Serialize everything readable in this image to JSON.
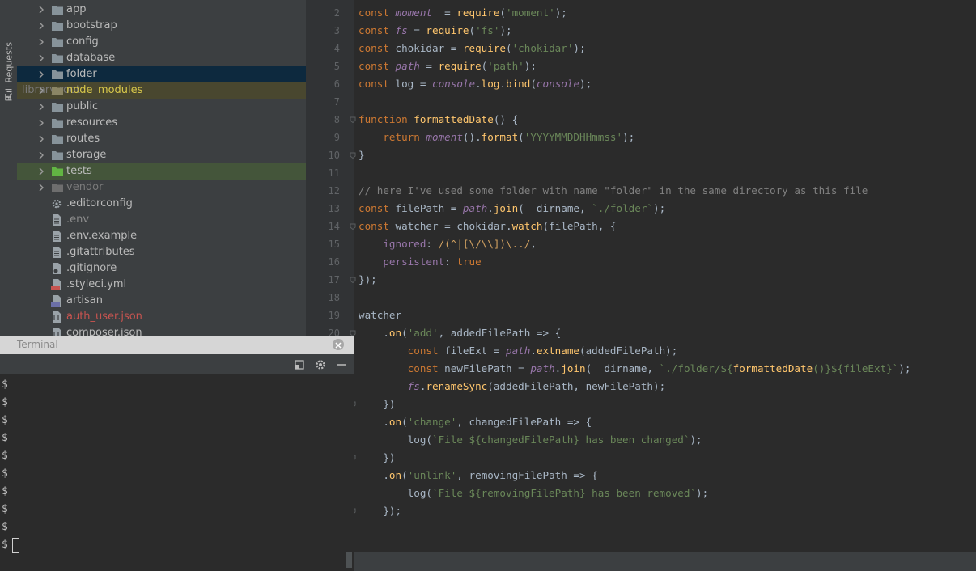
{
  "toolstrip": {
    "pull_requests_label": "Pull Requests"
  },
  "tree": {
    "folders": [
      {
        "label": "app",
        "state": "normal"
      },
      {
        "label": "bootstrap",
        "state": "normal"
      },
      {
        "label": "config",
        "state": "normal"
      },
      {
        "label": "database",
        "state": "normal"
      },
      {
        "label": "folder",
        "state": "selected"
      },
      {
        "label": "node_modules",
        "state": "library",
        "suffix": "library root"
      },
      {
        "label": "public",
        "state": "normal"
      },
      {
        "label": "resources",
        "state": "normal"
      },
      {
        "label": "routes",
        "state": "normal"
      },
      {
        "label": "storage",
        "state": "normal"
      },
      {
        "label": "tests",
        "state": "tests"
      },
      {
        "label": "vendor",
        "state": "excluded"
      }
    ],
    "files": [
      {
        "label": ".editorconfig",
        "icon": "gear-icon",
        "color": "#bbbbbb"
      },
      {
        "label": ".env",
        "icon": "text-file-icon",
        "color": "#8c8c8c"
      },
      {
        "label": ".env.example",
        "icon": "text-file-icon",
        "color": "#bbbbbb"
      },
      {
        "label": ".gitattributes",
        "icon": "text-file-icon",
        "color": "#bbbbbb"
      },
      {
        "label": ".gitignore",
        "icon": "gitignore-file-icon",
        "color": "#bbbbbb"
      },
      {
        "label": ".styleci.yml",
        "icon": "yaml-file-icon",
        "color": "#bbbbbb"
      },
      {
        "label": "artisan",
        "icon": "php-file-icon",
        "color": "#bbbbbb"
      },
      {
        "label": "auth_user.json",
        "icon": "json-file-icon",
        "color": "#c75450"
      },
      {
        "label": "composer.json",
        "icon": "json-file-icon",
        "color": "#bbbbbb"
      }
    ]
  },
  "editor": {
    "line_numbers": [
      "2",
      "3",
      "4",
      "5",
      "6",
      "7",
      "8",
      "9",
      "10",
      "11",
      "12",
      "13",
      "14",
      "15",
      "16",
      "17",
      "18",
      "19",
      "20"
    ],
    "lines": [
      [
        [
          "kw",
          "const "
        ],
        [
          "pv",
          "moment"
        ],
        [
          "",
          "  = "
        ],
        [
          "fn",
          "require"
        ],
        [
          "",
          "("
        ],
        [
          "str",
          "'moment'"
        ],
        [
          "",
          ");"
        ]
      ],
      [
        [
          "kw",
          "const "
        ],
        [
          "pv",
          "fs"
        ],
        [
          "",
          " = "
        ],
        [
          "fn",
          "require"
        ],
        [
          "",
          "("
        ],
        [
          "str",
          "'fs'"
        ],
        [
          "",
          ");"
        ]
      ],
      [
        [
          "kw",
          "const "
        ],
        [
          "",
          "chokidar = "
        ],
        [
          "fn",
          "require"
        ],
        [
          "",
          "("
        ],
        [
          "str",
          "'chokidar'"
        ],
        [
          "",
          ");"
        ]
      ],
      [
        [
          "kw",
          "const "
        ],
        [
          "pv",
          "path"
        ],
        [
          "",
          " = "
        ],
        [
          "fn",
          "require"
        ],
        [
          "",
          "("
        ],
        [
          "str",
          "'path'"
        ],
        [
          "",
          ");"
        ]
      ],
      [
        [
          "kw",
          "const "
        ],
        [
          "",
          "log = "
        ],
        [
          "pv",
          "console"
        ],
        [
          "",
          "."
        ],
        [
          "fn",
          "log"
        ],
        [
          "",
          "."
        ],
        [
          "fn",
          "bind"
        ],
        [
          "",
          "("
        ],
        [
          "pv",
          "console"
        ],
        [
          "",
          ");"
        ]
      ],
      [],
      [
        [
          "kw",
          "function "
        ],
        [
          "fn",
          "formattedDate"
        ],
        [
          "",
          "() {"
        ]
      ],
      [
        [
          "",
          "    "
        ],
        [
          "kw",
          "return "
        ],
        [
          "pv",
          "moment"
        ],
        [
          "",
          "()."
        ],
        [
          "fn",
          "format"
        ],
        [
          "",
          "("
        ],
        [
          "str",
          "'YYYYMMDDHHmmss'"
        ],
        [
          "",
          ");"
        ]
      ],
      [
        [
          "",
          "}"
        ]
      ],
      [],
      [
        [
          "cm",
          "// here I've used some folder with name \"folder\" in the same directory as this file"
        ]
      ],
      [
        [
          "kw",
          "const "
        ],
        [
          "",
          "filePath = "
        ],
        [
          "pv",
          "path"
        ],
        [
          "",
          "."
        ],
        [
          "fn",
          "join"
        ],
        [
          "",
          "(__dirname, "
        ],
        [
          "str",
          "`./folder`"
        ],
        [
          "",
          ");"
        ]
      ],
      [
        [
          "kw",
          "const "
        ],
        [
          "",
          "watcher = chokidar."
        ],
        [
          "fn",
          "watch"
        ],
        [
          "",
          "(filePath, {"
        ]
      ],
      [
        [
          "",
          "    "
        ],
        [
          "prop",
          "ignored"
        ],
        [
          "",
          ": "
        ],
        [
          "rx",
          "/(^|[\\/\\\\])\\../"
        ],
        [
          "",
          ","
        ]
      ],
      [
        [
          "",
          "    "
        ],
        [
          "prop",
          "persistent"
        ],
        [
          "",
          ": "
        ],
        [
          "kw",
          "true"
        ]
      ],
      [
        [
          "",
          "});"
        ]
      ],
      [],
      [
        [
          "",
          "watcher"
        ]
      ],
      [
        [
          "",
          "    ."
        ],
        [
          "fn",
          "on"
        ],
        [
          "",
          "("
        ],
        [
          "str",
          "'add'"
        ],
        [
          "",
          ", addedFilePath => {"
        ]
      ],
      [
        [
          "",
          "        "
        ],
        [
          "kw",
          "const "
        ],
        [
          "",
          "fileExt = "
        ],
        [
          "pv",
          "path"
        ],
        [
          "",
          "."
        ],
        [
          "fn",
          "extname"
        ],
        [
          "",
          "(addedFilePath);"
        ]
      ],
      [
        [
          "",
          "        "
        ],
        [
          "kw",
          "const "
        ],
        [
          "",
          "newFilePath = "
        ],
        [
          "pv",
          "path"
        ],
        [
          "",
          "."
        ],
        [
          "fn",
          "join"
        ],
        [
          "",
          "(__dirname, "
        ],
        [
          "str",
          "`./folder/${"
        ],
        [
          "fn",
          "formattedDate"
        ],
        [
          "str",
          "()}${fileExt}`"
        ],
        [
          "",
          ");"
        ]
      ],
      [
        [
          "",
          "        "
        ],
        [
          "pv",
          "fs"
        ],
        [
          "",
          "."
        ],
        [
          "fn",
          "renameSync"
        ],
        [
          "",
          "(addedFilePath, newFilePath);"
        ]
      ],
      [
        [
          "",
          "    })"
        ]
      ],
      [
        [
          "",
          "    ."
        ],
        [
          "fn",
          "on"
        ],
        [
          "",
          "("
        ],
        [
          "str",
          "'change'"
        ],
        [
          "",
          ", changedFilePath => {"
        ]
      ],
      [
        [
          "",
          "        log("
        ],
        [
          "str",
          "`File ${changedFilePath} has been changed`"
        ],
        [
          "",
          ");"
        ]
      ],
      [
        [
          "",
          "    })"
        ]
      ],
      [
        [
          "",
          "    ."
        ],
        [
          "fn",
          "on"
        ],
        [
          "",
          "("
        ],
        [
          "str",
          "'unlink'"
        ],
        [
          "",
          ", removingFilePath => {"
        ]
      ],
      [
        [
          "",
          "        log("
        ],
        [
          "str",
          "`File ${removingFilePath} has been removed`"
        ],
        [
          "",
          ");"
        ]
      ],
      [
        [
          "",
          "    });"
        ]
      ]
    ]
  },
  "terminal": {
    "title": "Terminal",
    "prompt": "$",
    "prompt_count": 10
  },
  "colors": {
    "accent_selected": "#0d293e",
    "library_bg": "#49472f",
    "tests_bg": "#44553a",
    "error_file": "#c75450"
  }
}
